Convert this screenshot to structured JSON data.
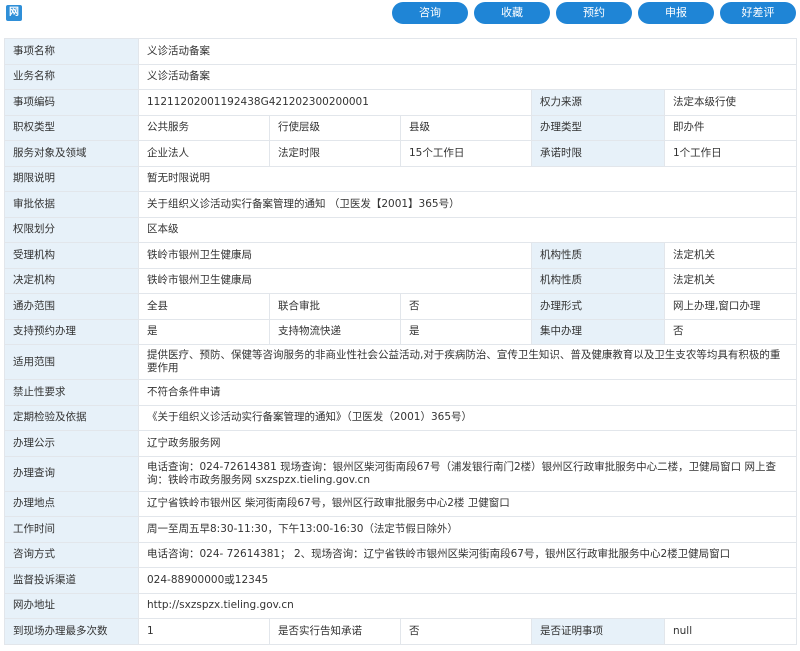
{
  "logo_text": "网",
  "buttons": [
    {
      "label": "咨询",
      "name": "consult-button"
    },
    {
      "label": "收藏",
      "name": "favorite-button"
    },
    {
      "label": "预约",
      "name": "appointment-button"
    },
    {
      "label": "申报",
      "name": "apply-button"
    },
    {
      "label": "好差评",
      "name": "rating-button"
    }
  ],
  "rows": [
    [
      {
        "t": "事项名称",
        "l": 1
      },
      {
        "t": "义诊活动备案",
        "s": 5
      }
    ],
    [
      {
        "t": "业务名称",
        "l": 1
      },
      {
        "t": "义诊活动备案",
        "s": 5
      }
    ],
    [
      {
        "t": "事项编码",
        "l": 1
      },
      {
        "t": "11211202001192438G421202300200001",
        "s": 3
      },
      {
        "t": "权力来源",
        "l": 1
      },
      {
        "t": "法定本级行使"
      }
    ],
    [
      {
        "t": "职权类型",
        "l": 1
      },
      {
        "t": "公共服务"
      },
      {
        "t": "行使层级"
      },
      {
        "t": "县级"
      },
      {
        "t": "办理类型",
        "l": 1
      },
      {
        "t": "即办件"
      }
    ],
    [
      {
        "t": "服务对象及领域",
        "l": 1
      },
      {
        "t": "企业法人"
      },
      {
        "t": "法定时限"
      },
      {
        "t": "15个工作日"
      },
      {
        "t": "承诺时限",
        "l": 1
      },
      {
        "t": "1个工作日"
      }
    ],
    [
      {
        "t": "期限说明",
        "l": 1
      },
      {
        "t": "暂无时限说明",
        "s": 5
      }
    ],
    [
      {
        "t": "审批依据",
        "l": 1
      },
      {
        "t": "关于组织义诊活动实行备案管理的通知 （卫医发【2001】365号）",
        "s": 5
      }
    ],
    [
      {
        "t": "权限划分",
        "l": 1
      },
      {
        "t": "区本级",
        "s": 5
      }
    ],
    [
      {
        "t": "受理机构",
        "l": 1
      },
      {
        "t": "铁岭市银州卫生健康局",
        "s": 3
      },
      {
        "t": "机构性质",
        "l": 1
      },
      {
        "t": "法定机关"
      }
    ],
    [
      {
        "t": "决定机构",
        "l": 1
      },
      {
        "t": "铁岭市银州卫生健康局",
        "s": 3
      },
      {
        "t": "机构性质",
        "l": 1
      },
      {
        "t": "法定机关"
      }
    ],
    [
      {
        "t": "通办范围",
        "l": 1
      },
      {
        "t": "全县"
      },
      {
        "t": "联合审批"
      },
      {
        "t": "否"
      },
      {
        "t": "办理形式",
        "l": 1
      },
      {
        "t": "网上办理,窗口办理"
      }
    ],
    [
      {
        "t": "支持预约办理",
        "l": 1
      },
      {
        "t": "是"
      },
      {
        "t": "支持物流快递"
      },
      {
        "t": "是"
      },
      {
        "t": "集中办理",
        "l": 1
      },
      {
        "t": "否"
      }
    ],
    [
      {
        "t": "适用范围",
        "l": 1
      },
      {
        "t": "提供医疗、预防、保健等咨询服务的非商业性社会公益活动,对于疾病防治、宣传卫生知识、普及健康教育以及卫生支农等均具有积极的重要作用",
        "s": 5,
        "tall": 1
      }
    ],
    [
      {
        "t": "禁止性要求",
        "l": 1
      },
      {
        "t": "不符合条件申请",
        "s": 5
      }
    ],
    [
      {
        "t": "定期检验及依据",
        "l": 1
      },
      {
        "t": "《关于组织义诊活动实行备案管理的通知》（卫医发（2001）365号）",
        "s": 5
      }
    ],
    [
      {
        "t": "办理公示",
        "l": 1
      },
      {
        "t": "辽宁政务服务网",
        "s": 5
      }
    ],
    [
      {
        "t": "办理查询",
        "l": 1
      },
      {
        "t": "电话查询：024-72614381 现场查询：银州区柴河街南段67号（浦发银行南门2楼）银州区行政审批服务中心二楼，卫健局窗口 网上查询：铁岭市政务服务网 sxzspzx.tieling.gov.cn",
        "s": 5,
        "tall": 1
      }
    ],
    [
      {
        "t": "办理地点",
        "l": 1
      },
      {
        "t": "辽宁省铁岭市银州区 柴河街南段67号，银州区行政审批服务中心2楼 卫健窗口",
        "s": 5
      }
    ],
    [
      {
        "t": "工作时间",
        "l": 1
      },
      {
        "t": "周一至周五早8:30-11:30，下午13:00-16:30（法定节假日除外）",
        "s": 5
      }
    ],
    [
      {
        "t": "咨询方式",
        "l": 1
      },
      {
        "t": "电话咨询：024- 72614381； 2、现场咨询：辽宁省铁岭市银州区柴河街南段67号，银州区行政审批服务中心2楼卫健局窗口",
        "s": 5
      }
    ],
    [
      {
        "t": "监督投诉渠道",
        "l": 1
      },
      {
        "t": "024-88900000或12345",
        "s": 5
      }
    ],
    [
      {
        "t": "网办地址",
        "l": 1
      },
      {
        "t": "http://sxzspzx.tieling.gov.cn",
        "s": 5
      }
    ],
    [
      {
        "t": "到现场办理最多次数",
        "l": 1
      },
      {
        "t": "1"
      },
      {
        "t": "是否实行告知承诺"
      },
      {
        "t": "否"
      },
      {
        "t": "是否证明事项",
        "l": 1
      },
      {
        "t": "null"
      }
    ]
  ]
}
